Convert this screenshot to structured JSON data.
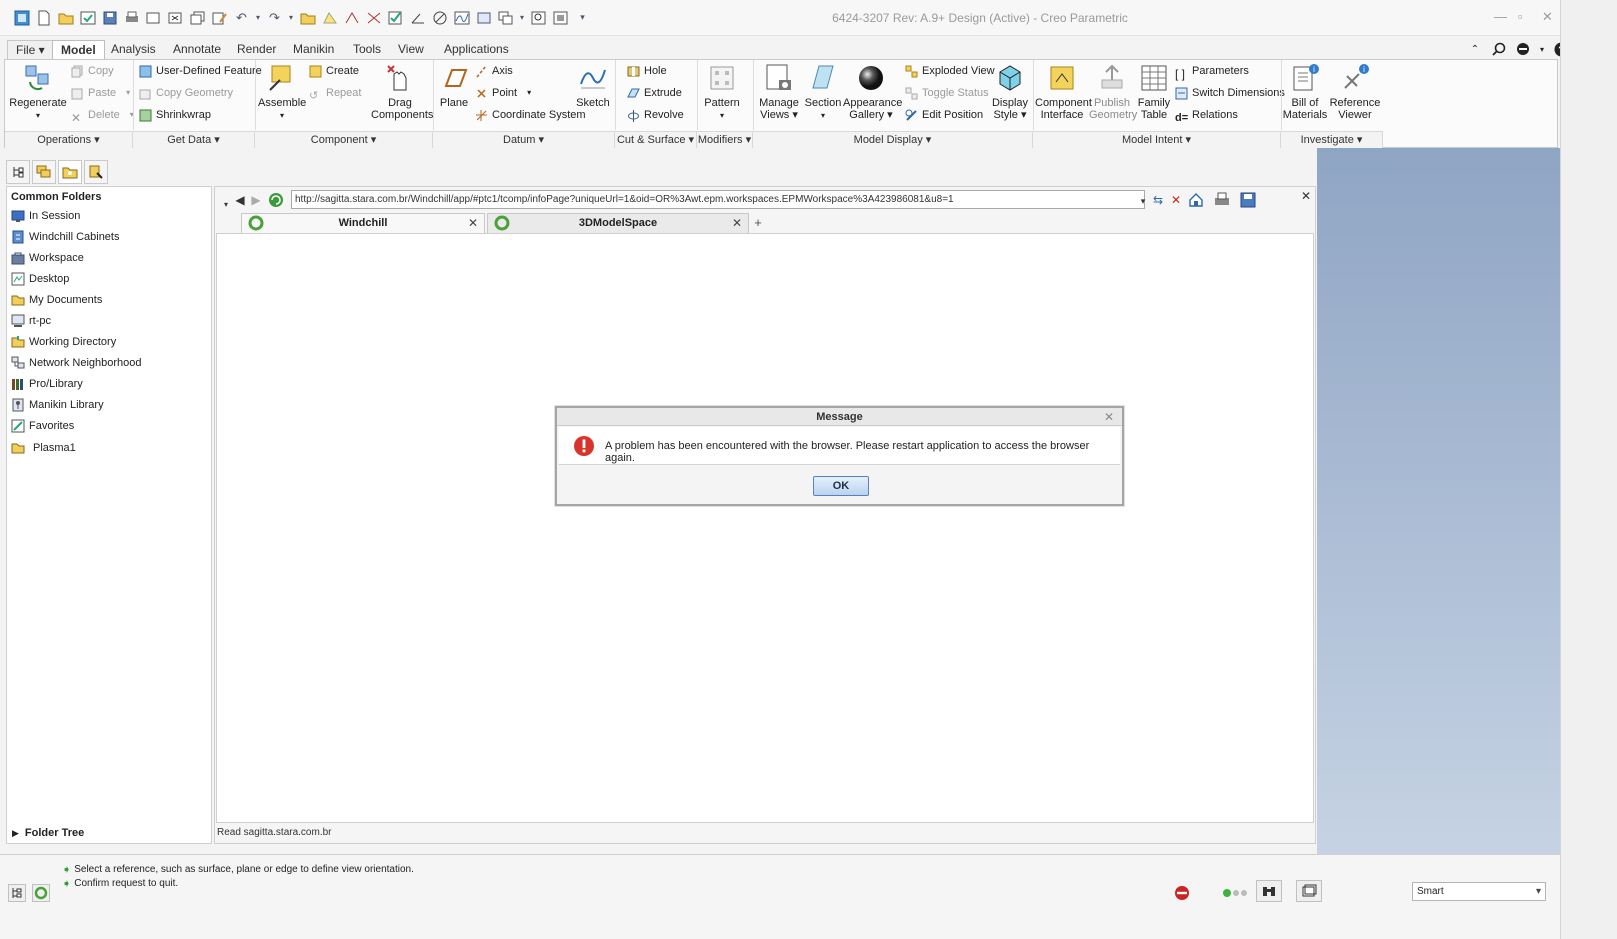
{
  "window": {
    "title": "6424-3207 Rev: A.9+ Design  (Active) - Creo Parametric"
  },
  "menu": {
    "tabs": [
      "File ▾",
      "Model",
      "Analysis",
      "Annotate",
      "Render",
      "Manikin",
      "Tools",
      "View",
      "Applications"
    ],
    "active_tab": "Model"
  },
  "ribbon": {
    "operations": {
      "regenerate": "Regenerate",
      "copy": "Copy",
      "paste": "Paste",
      "delete": "Delete",
      "label": "Operations ▾"
    },
    "get_data": {
      "user_defined_feature": "User-Defined Feature",
      "copy_geometry": "Copy Geometry",
      "shrinkwrap": "Shrinkwrap",
      "label": "Get Data ▾"
    },
    "component": {
      "assemble": "Assemble",
      "create": "Create",
      "repeat": "Repeat",
      "drag_components_1": "Drag",
      "drag_components_2": "Components",
      "label": "Component ▾"
    },
    "datum": {
      "plane": "Plane",
      "axis": "Axis",
      "point": "Point",
      "coordinate_system": "Coordinate System",
      "sketch": "Sketch",
      "label": "Datum ▾"
    },
    "cut_surface": {
      "hole": "Hole",
      "extrude": "Extrude",
      "revolve": "Revolve",
      "label": "Cut & Surface ▾"
    },
    "modifiers": {
      "pattern": "Pattern",
      "label": "Modifiers ▾"
    },
    "model_display": {
      "manage_views_1": "Manage",
      "manage_views_2": "Views ▾",
      "section": "Section",
      "appearance_gallery_1": "Appearance",
      "appearance_gallery_2": "Gallery ▾",
      "exploded_view": "Exploded View",
      "toggle_status": "Toggle Status",
      "edit_position": "Edit Position",
      "display_style_1": "Display",
      "display_style_2": "Style ▾",
      "label": "Model Display ▾"
    },
    "model_intent": {
      "component_interface_1": "Component",
      "component_interface_2": "Interface",
      "publish_geometry_1": "Publish",
      "publish_geometry_2": "Geometry",
      "family_table_1": "Family",
      "family_table_2": "Table",
      "parameters": "Parameters",
      "switch_dimensions": "Switch Dimensions",
      "relations": "Relations",
      "label": "Model Intent ▾"
    },
    "investigate": {
      "bill_of_materials_1": "Bill of",
      "bill_of_materials_2": "Materials",
      "reference_viewer_1": "Reference",
      "reference_viewer_2": "Viewer",
      "label": "Investigate ▾"
    }
  },
  "folders": {
    "heading": "Common Folders",
    "items": [
      "In Session",
      "Windchill Cabinets",
      "Workspace",
      "Desktop",
      "My Documents",
      "rt-pc",
      "Working Directory",
      "Network Neighborhood",
      "Pro/Library",
      "Manikin Library",
      "Favorites",
      "Plasma1"
    ],
    "folder_tree": "Folder Tree"
  },
  "browser": {
    "url": "http://sagitta.stara.com.br/Windchill/app/#ptc1/tcomp/infoPage?uniqueUrl=1&oid=OR%3Awt.epm.workspaces.EPMWorkspace%3A423986081&u8=1",
    "tabs": [
      "Windchill",
      "3DModelSpace"
    ],
    "status": "Read sagitta.stara.com.br"
  },
  "dialog": {
    "title": "Message",
    "message": "A problem has been encountered with the browser. Please restart application to access the browser again.",
    "ok": "OK"
  },
  "messages": [
    "Select a reference, such as surface, plane or edge to define view orientation.",
    "Confirm request to quit."
  ],
  "filter": {
    "value": "Smart"
  },
  "colors": {
    "accent_blue": "#1f5fa8",
    "error_red": "#d9342b",
    "ok_green": "#2f9d2f",
    "graphics_bg": "#a9bbd4"
  }
}
